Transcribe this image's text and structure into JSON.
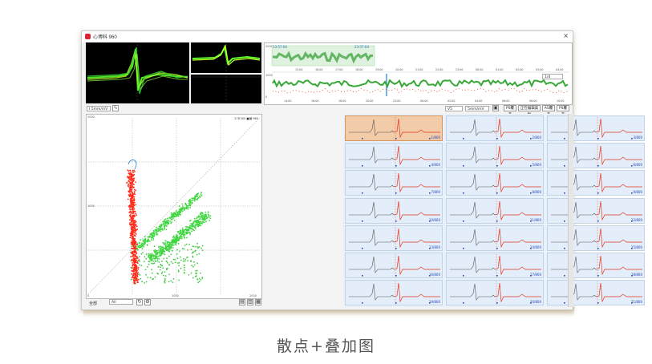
{
  "window": {
    "title": "心博科 960"
  },
  "toolbar_left": {
    "lead_select": "I 5mm/mV"
  },
  "trend": {
    "time_start": "13:57:04",
    "time_end": "23:57:04",
    "zoom_select": "1/4",
    "hour_ticks_top": [
      "15:00",
      "16:00",
      "17:00",
      "18:00",
      "19:00",
      "20:00",
      "21:00",
      "22:00",
      "23:00",
      "00:00",
      "01:00",
      "02:00",
      "03:00",
      "04:00"
    ],
    "hour_ticks_bottom": [
      "14:00",
      "16:00",
      "18:00",
      "20:00",
      "22:00",
      "00:00",
      "02:00",
      "04:00",
      "06:00",
      "08:00",
      "10:00"
    ],
    "y_top": "2000",
    "y_mid": "1000",
    "y_bottom": "0"
  },
  "beat_toolbar": {
    "lead_select": "V5",
    "gain_select": "5mm/mV",
    "buttons": [
      "PS覆盖",
      "正在编辑类别",
      "AS覆盖",
      "PS覆盖"
    ]
  },
  "scatter": {
    "info": "278  N/V  ■编 960",
    "y_top": "2000",
    "y_mid": "1000",
    "x_mid": "1000",
    "x_end": "2000",
    "x_zero": "0",
    "bottom_label": "全部",
    "bottom_select": "All"
  },
  "cells": [
    "1/800",
    "2/800",
    "3/800",
    "4/800",
    "5/800",
    "6/800",
    "7/800",
    "8/800",
    "9/800",
    "10/800",
    "11/800",
    "12/800",
    "13/800",
    "14/800",
    "15/800",
    "16/800",
    "17/800",
    "18/800",
    "19/800",
    "20/800",
    "21/800"
  ],
  "caption": "散点+叠加图",
  "colors": {
    "green": "#3ed63e",
    "red": "#ff2a1a",
    "accent": "#1b7ed6",
    "selected_cell": "#f2cba8"
  }
}
